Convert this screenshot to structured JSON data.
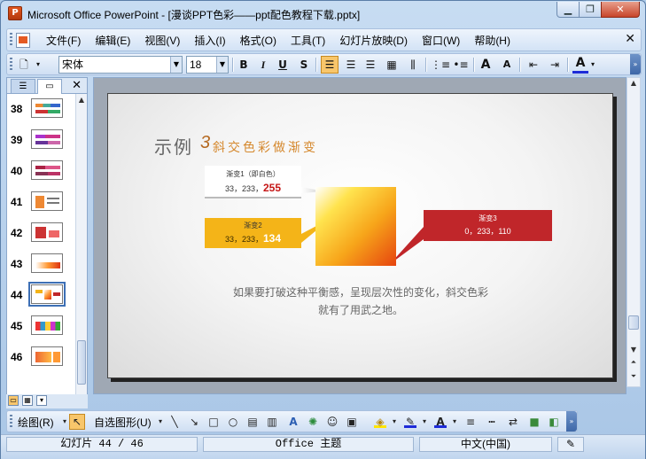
{
  "window": {
    "title": "Microsoft Office PowerPoint - [漫谈PPT色彩——ppt配色教程下载.pptx]",
    "buttons": {
      "minimize": "▁",
      "restore": "❐",
      "close": "✕"
    }
  },
  "menu": {
    "items": [
      "文件(F)",
      "编辑(E)",
      "视图(V)",
      "插入(I)",
      "格式(O)",
      "工具(T)",
      "幻灯片放映(D)",
      "窗口(W)",
      "帮助(H)"
    ],
    "close_glyph": "✕"
  },
  "format_toolbar": {
    "font_name": "宋体",
    "font_size": "18",
    "bold": "B",
    "italic": "I",
    "underline": "U",
    "shadow": "S",
    "font_color_letter": "A",
    "grow_font": "A",
    "shrink_font": "A"
  },
  "slide_panel": {
    "current": 44,
    "slides": [
      {
        "num": "38"
      },
      {
        "num": "39"
      },
      {
        "num": "40"
      },
      {
        "num": "41"
      },
      {
        "num": "42"
      },
      {
        "num": "43"
      },
      {
        "num": "44"
      },
      {
        "num": "45"
      },
      {
        "num": "46"
      }
    ]
  },
  "slide": {
    "title_main": "示例",
    "title_num": "3",
    "title_sub": "斜交色彩做渐变",
    "box1": {
      "label": "渐变1（即白色）",
      "value_prefix": "33，233，",
      "value_highlight": "255"
    },
    "box2": {
      "label": "渐变2",
      "value_prefix": "33，233，",
      "value_highlight": "134"
    },
    "box3": {
      "label": "渐变3",
      "value": "0，233，110"
    },
    "body_line1": "如果要打破这种平衡感，呈现层次性的变化，斜交色彩",
    "body_line2": "就有了用武之地。",
    "colors": {
      "box2": "#f4b418",
      "box3": "#c0262a",
      "highlight": "#c51616"
    }
  },
  "draw_toolbar": {
    "draw_label": "绘图(R)",
    "autoshape_label": "自选图形(U)"
  },
  "status": {
    "slide_info": "幻灯片 44 / 46",
    "theme": "Office 主题",
    "language": "中文(中国)"
  }
}
